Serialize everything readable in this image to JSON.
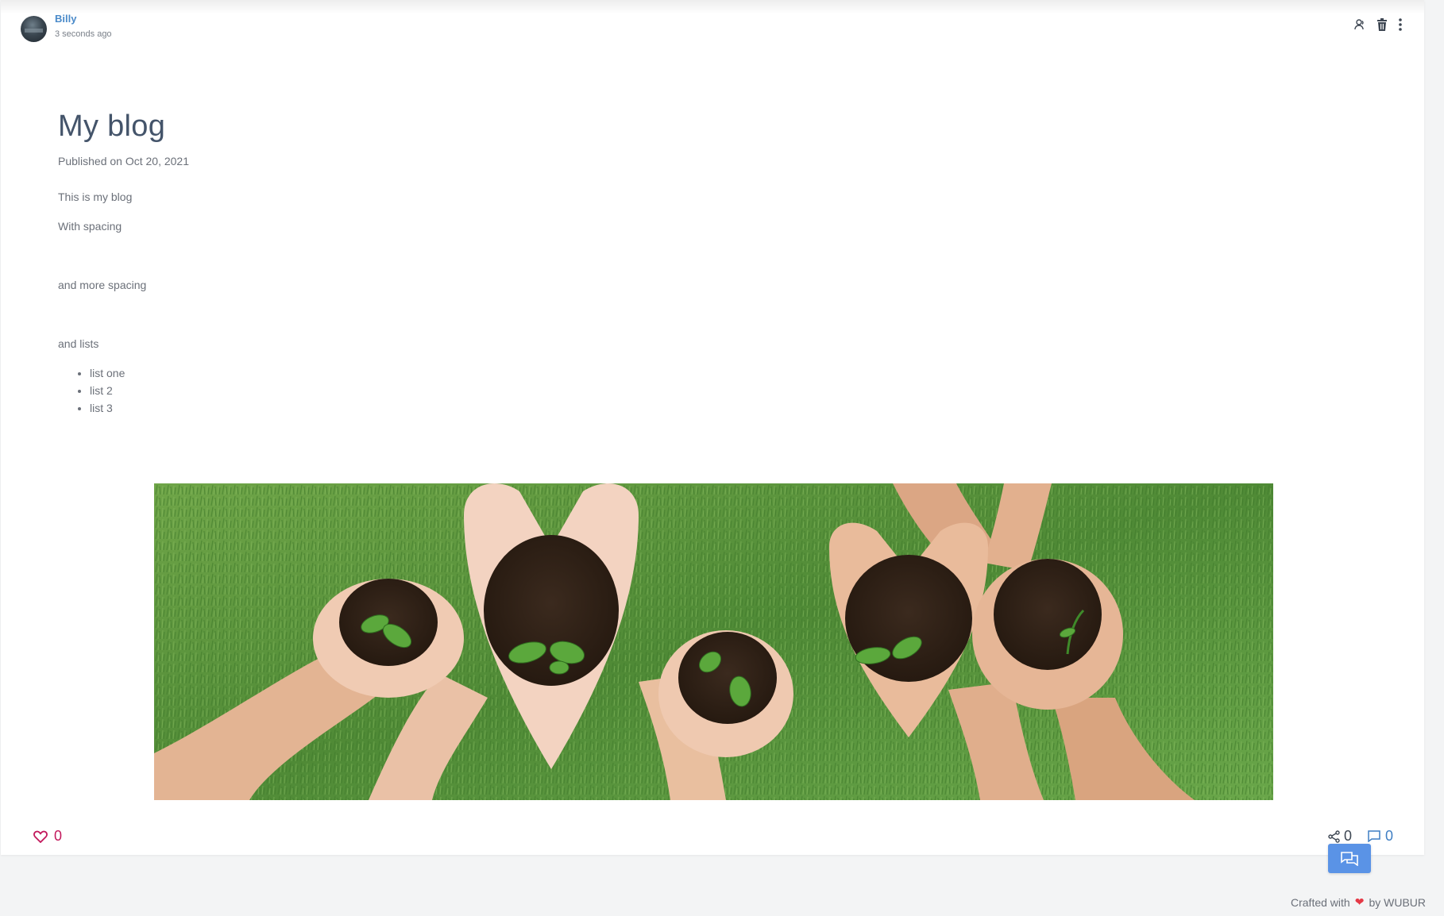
{
  "post": {
    "author": "Billy",
    "time_ago": "3 seconds ago",
    "title": "My blog",
    "published": "Published on Oct 20, 2021",
    "paragraphs": [
      "This is my blog",
      "With spacing",
      "and more spacing",
      "and lists"
    ],
    "list_items": [
      "list one",
      "list 2",
      "list 3"
    ],
    "image": "seedlings in cupped hands over grass"
  },
  "header_icons": [
    "user-icon",
    "trash-icon",
    "more-vertical-icon"
  ],
  "actions": {
    "likes": "0",
    "shares": "0",
    "comments": "0"
  },
  "footer": {
    "crafted_prefix": "Crafted with",
    "crafted_suffix": "by WUBUR"
  },
  "colors": {
    "accent": "#4a8ac9",
    "like": "#c2185b",
    "fab": "#5a93e6",
    "heart": "#e53946",
    "title": "#44546a"
  }
}
